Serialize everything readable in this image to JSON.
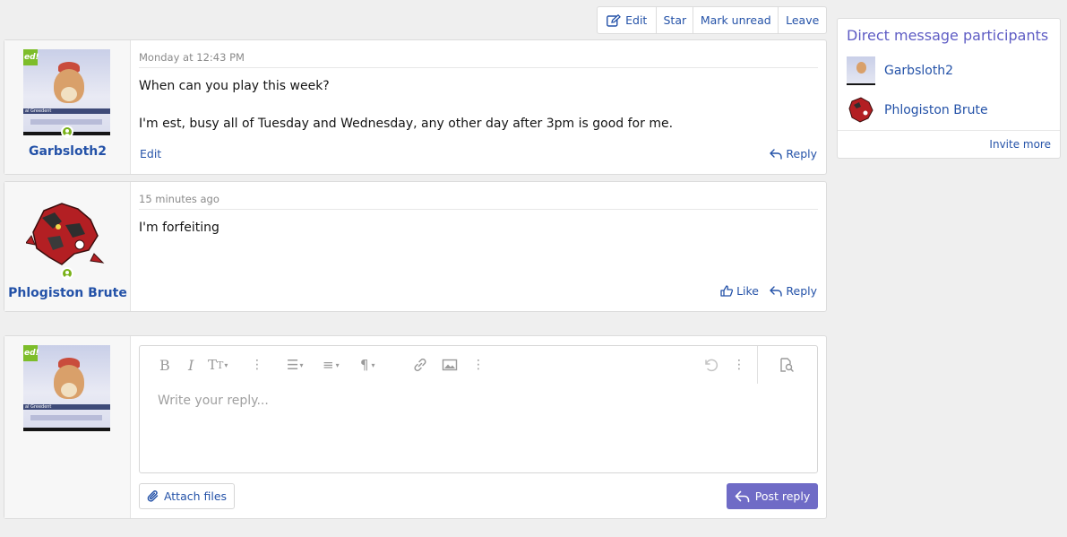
{
  "toolbar": {
    "edit_label": "Edit",
    "star_label": "Star",
    "mark_unread_label": "Mark unread",
    "leave_label": "Leave"
  },
  "messages": [
    {
      "author": "Garbsloth2",
      "time": "Monday at 12:43 PM",
      "lines": [
        "When can you play this week?",
        "I'm est, busy all of Tuesday and Wednesday, any other day after 3pm is good for me."
      ],
      "edit_label": "Edit",
      "reply_label": "Reply"
    },
    {
      "author": "Phlogiston Brute",
      "time": "15 minutes ago",
      "lines": [
        "I'm forfeiting"
      ],
      "like_label": "Like",
      "reply_label": "Reply"
    }
  ],
  "avatar_text": {
    "banner": "ed!",
    "caption": "al Greedent"
  },
  "composer": {
    "placeholder": "Write your reply...",
    "attach_label": "Attach files",
    "post_label": "Post reply"
  },
  "sidebar": {
    "title": "Direct message participants",
    "participants": [
      "Garbsloth2",
      "Phlogiston Brute"
    ],
    "invite_label": "Invite more"
  },
  "colors": {
    "accent": "#2452a8",
    "post_button": "#6f6bc6",
    "sidebar_title": "#5e5cc4",
    "online": "#7ab21a"
  }
}
